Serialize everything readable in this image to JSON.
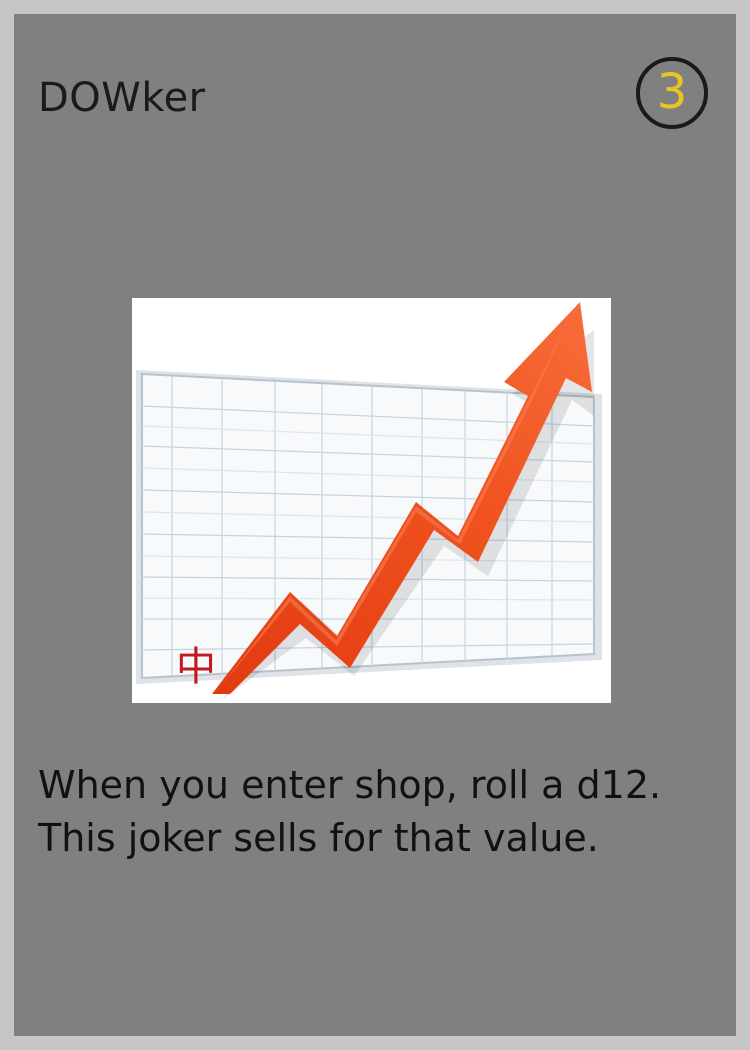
{
  "card": {
    "name": "DOWker",
    "cost": "3",
    "rules_lines": [
      "When you enter shop, roll a d12.",
      "This joker sells for that value."
    ],
    "art": {
      "icon": "rising-stock-chart-arrow",
      "corner_glyph": "中",
      "colors": {
        "arrow": "#ee4b1c",
        "arrow_highlight": "#f7845a",
        "grid": "#c7d3de",
        "board": "#f7f9fb",
        "glyph": "#c0191f"
      }
    },
    "colors": {
      "card_background": "#808080",
      "frame": "#c6c6c6",
      "cost_digit": "#e8c61f",
      "text": "#111111"
    }
  }
}
